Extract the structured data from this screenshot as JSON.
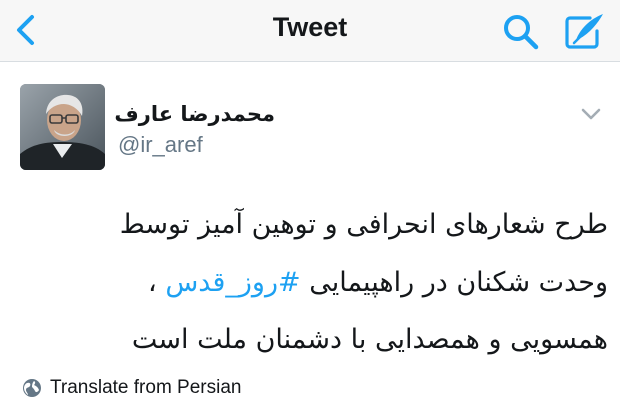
{
  "header": {
    "title": "Tweet",
    "back_icon": "chevron-left-icon",
    "search_icon": "search-icon",
    "compose_icon": "compose-tweet-icon",
    "accent_color": "#1da1f2"
  },
  "tweet": {
    "author": {
      "display_name": "محمدرضا عارف",
      "username": "@ir_aref",
      "avatar_icon": "profile-photo"
    },
    "menu_icon": "chevron-down-icon",
    "body": {
      "line1": "طرح شعارهای انحرافی و توهین آمیز توسط",
      "line2_before": "وحدت شکنان در راهپیمایی ",
      "hashtag": "#روز_قدس",
      "line2_after": " ،",
      "line3": "همسویی و همصدایی با دشمنان ملت است"
    },
    "translate": {
      "label": "Translate from Persian",
      "icon": "globe-icon"
    }
  }
}
